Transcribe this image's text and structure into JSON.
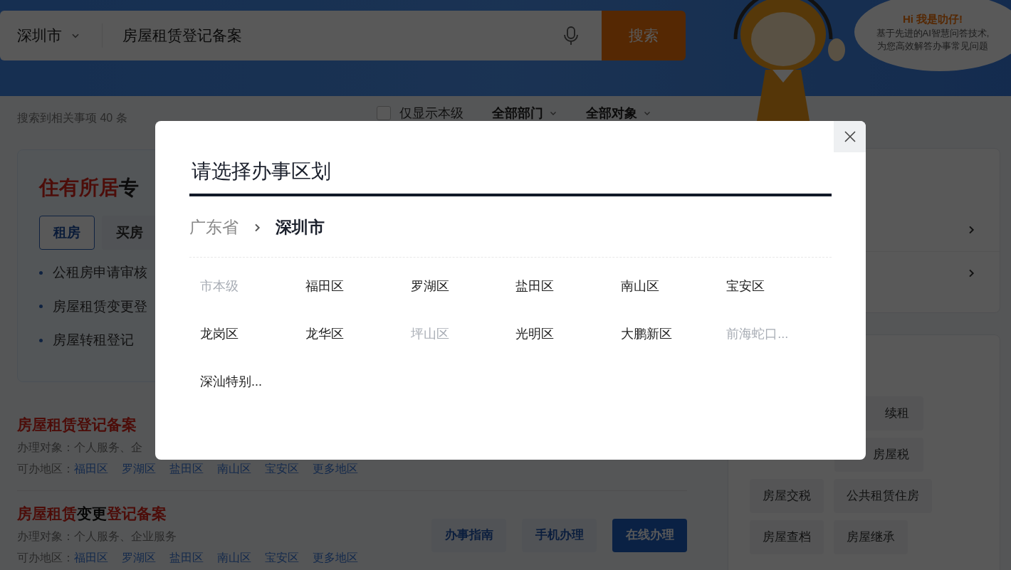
{
  "search": {
    "city": "深圳市",
    "query": "房屋租赁登记备案",
    "button": "搜索"
  },
  "assistant": {
    "greeting": "Hi 我是叻仔!",
    "lines": [
      "基于先进的AI智慧问答技术,",
      "为您高效解答办事常见问题"
    ]
  },
  "results_count": "搜索到相关事项 40 条",
  "filters": {
    "only_this_level": {
      "label": "仅显示本级",
      "checked": false
    },
    "dropdowns": [
      "全部部门",
      "全部对象"
    ]
  },
  "feature_card": {
    "title": [
      {
        "text": "住有所居",
        "highlight": true
      },
      {
        "text": "专",
        "highlight": false
      }
    ],
    "tabs": [
      {
        "label": "租房",
        "selected": true
      },
      {
        "label": "买房",
        "selected": false
      }
    ],
    "items": [
      "公租房申请审核",
      "房屋租赁变更登",
      "房屋转租登记"
    ]
  },
  "results": [
    {
      "title": [
        {
          "text": "房屋租赁登记备案",
          "highlight": true
        }
      ],
      "target": "办理对象：个人服务、企",
      "regions_label": "可办地区：",
      "regions": [
        "福田区",
        "罗湖区",
        "盐田区",
        "南山区",
        "宝安区",
        "更多地区"
      ]
    },
    {
      "title": [
        {
          "text": "房屋租赁",
          "highlight": true
        },
        {
          "text": "变更",
          "highlight": false
        },
        {
          "text": "登记备案",
          "highlight": true
        }
      ],
      "target": "办理对象：个人服务、企业服务",
      "regions_label": "可办地区：",
      "regions": [
        "福田区",
        "罗湖区",
        "盐田区",
        "南山区",
        "宝安区",
        "更多地区"
      ],
      "actions": [
        {
          "label": "办事指南",
          "primary": false
        },
        {
          "label": "手机办理",
          "primary": false
        },
        {
          "label": "在线办理",
          "primary": true
        }
      ]
    }
  ],
  "tag_rows": [
    [
      "续租"
    ],
    [
      "房屋税"
    ],
    [
      "房屋交税",
      "公共租赁住房"
    ],
    [
      "房屋查档",
      "房屋继承"
    ]
  ],
  "dialog": {
    "title": "请选择办事区划",
    "breadcrumb": [
      {
        "label": "广东省",
        "current": false
      },
      {
        "label": "深圳市",
        "current": true
      }
    ],
    "districts": [
      {
        "name": "市本级",
        "disabled": true
      },
      {
        "name": "福田区",
        "disabled": false
      },
      {
        "name": "罗湖区",
        "disabled": false
      },
      {
        "name": "盐田区",
        "disabled": false
      },
      {
        "name": "南山区",
        "disabled": false
      },
      {
        "name": "宝安区",
        "disabled": false
      },
      {
        "name": "龙岗区",
        "disabled": false
      },
      {
        "name": "龙华区",
        "disabled": false
      },
      {
        "name": "坪山区",
        "disabled": true
      },
      {
        "name": "光明区",
        "disabled": false
      },
      {
        "name": "大鹏新区",
        "disabled": false
      },
      {
        "name": "前海蛇口...",
        "disabled": true
      },
      {
        "name": "深汕特别...",
        "disabled": false
      }
    ]
  }
}
